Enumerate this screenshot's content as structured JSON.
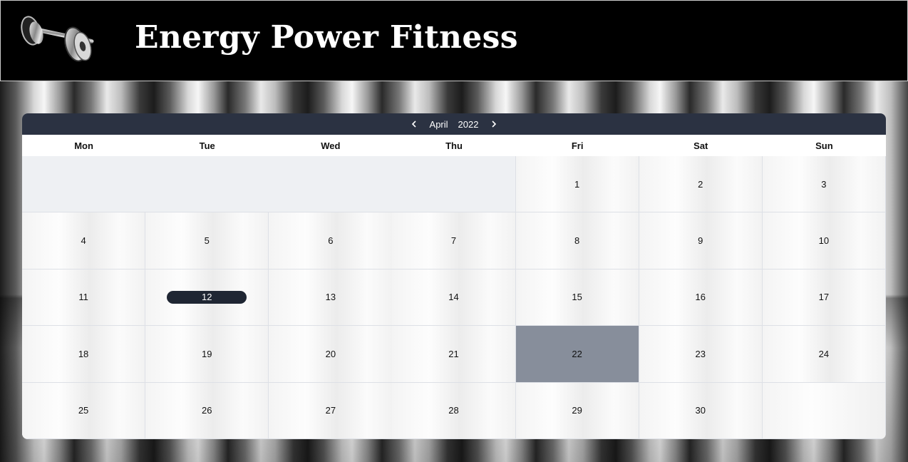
{
  "header": {
    "title": "Energy Power Fitness",
    "logo_icon": "dumbbell-icon"
  },
  "calendar": {
    "month": "April",
    "year": "2022",
    "prev_icon": "chevron-left-icon",
    "next_icon": "chevron-right-icon",
    "weekdays": [
      "Mon",
      "Tue",
      "Wed",
      "Thu",
      "Fri",
      "Sat",
      "Sun"
    ],
    "days": [
      "1",
      "2",
      "3",
      "4",
      "5",
      "6",
      "7",
      "8",
      "9",
      "10",
      "11",
      "12",
      "13",
      "14",
      "15",
      "16",
      "17",
      "18",
      "19",
      "20",
      "21",
      "22",
      "23",
      "24",
      "25",
      "26",
      "27",
      "28",
      "29",
      "30"
    ],
    "today": "12",
    "selected": "22",
    "colors": {
      "nav_bg": "#2b3242",
      "today_bg": "#1f2633",
      "selected_bg": "#878e9b"
    }
  }
}
